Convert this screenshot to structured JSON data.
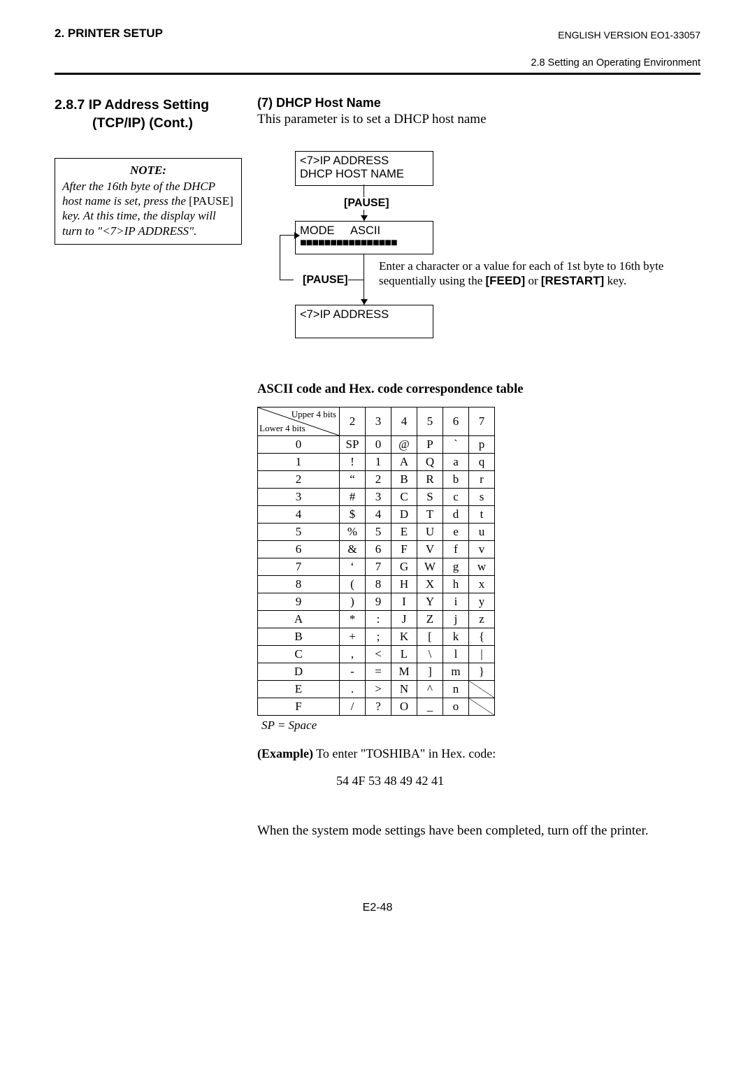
{
  "header": {
    "left": "2. PRINTER SETUP",
    "right": "ENGLISH VERSION EO1-33057",
    "sub": "2.8 Setting an Operating Environment"
  },
  "left": {
    "title_l1": "2.8.7  IP Address Setting",
    "title_l2": "(TCP/IP) (Cont.)",
    "note_title": "NOTE:",
    "note_before": "After the 16th byte of the DHCP host name is set, press the ",
    "note_key": "[PAUSE]",
    "note_after": " key.  At this time, the display will turn to \"<7>IP ADDRESS\"."
  },
  "right": {
    "subtitle": "(7)  DHCP Host Name",
    "desc": "This parameter is to set a DHCP host name",
    "box1_l1": "<7>IP ADDRESS",
    "box1_l2": "DHCP HOST NAME",
    "pause": "[PAUSE]",
    "box2_mode": "MODE",
    "box2_ascii": "ASCII",
    "box2_blocks": "■■■■■■■■■■■■■■■■",
    "box3": "<7>IP ADDRESS",
    "side1": "Enter a character or a value for each of 1st byte to 16th byte sequentially using the ",
    "side_feed": "[FEED]",
    "side_or": " or ",
    "side_restart": "[RESTART]",
    "side_key": " key.",
    "table_title": "ASCII code and Hex. code correspondence table",
    "corner_upper": "Upper 4 bits",
    "corner_lower": "Lower 4 bits",
    "footnote": "SP = Space",
    "example_b": "(Example)",
    "example_t": " To enter \"TOSHIBA\" in Hex. code:",
    "hex": "54 4F 53 48 49 42 41",
    "closing": "When the system mode settings have been completed, turn off the printer."
  },
  "table": {
    "cols": [
      "2",
      "3",
      "4",
      "5",
      "6",
      "7"
    ],
    "rows": [
      {
        "h": "0",
        "c": [
          "SP",
          "0",
          "@",
          "P",
          "`",
          "p"
        ]
      },
      {
        "h": "1",
        "c": [
          "!",
          "1",
          "A",
          "Q",
          "a",
          "q"
        ]
      },
      {
        "h": "2",
        "c": [
          "“",
          "2",
          "B",
          "R",
          "b",
          "r"
        ]
      },
      {
        "h": "3",
        "c": [
          "#",
          "3",
          "C",
          "S",
          "c",
          "s"
        ]
      },
      {
        "h": "4",
        "c": [
          "$",
          "4",
          "D",
          "T",
          "d",
          "t"
        ]
      },
      {
        "h": "5",
        "c": [
          "%",
          "5",
          "E",
          "U",
          "e",
          "u"
        ]
      },
      {
        "h": "6",
        "c": [
          "&",
          "6",
          "F",
          "V",
          "f",
          "v"
        ]
      },
      {
        "h": "7",
        "c": [
          "‘",
          "7",
          "G",
          "W",
          "g",
          "w"
        ]
      },
      {
        "h": "8",
        "c": [
          "(",
          "8",
          "H",
          "X",
          "h",
          "x"
        ]
      },
      {
        "h": "9",
        "c": [
          ")",
          "9",
          "I",
          "Y",
          "i",
          "y"
        ]
      },
      {
        "h": "A",
        "c": [
          "*",
          ":",
          "J",
          "Z",
          "j",
          "z"
        ]
      },
      {
        "h": "B",
        "c": [
          "+",
          ";",
          "K",
          "[",
          "k",
          "{"
        ]
      },
      {
        "h": "C",
        "c": [
          ",",
          "<",
          "L",
          "\\",
          "l",
          "|"
        ]
      },
      {
        "h": "D",
        "c": [
          "-",
          "=",
          "M",
          "]",
          "m",
          "}"
        ]
      },
      {
        "h": "E",
        "c": [
          ".",
          ">",
          "N",
          "^",
          "n",
          "SLASH"
        ]
      },
      {
        "h": "F",
        "c": [
          "/",
          "?",
          "O",
          "_",
          "o",
          "SLASH"
        ]
      }
    ]
  },
  "page_num": "E2-48"
}
